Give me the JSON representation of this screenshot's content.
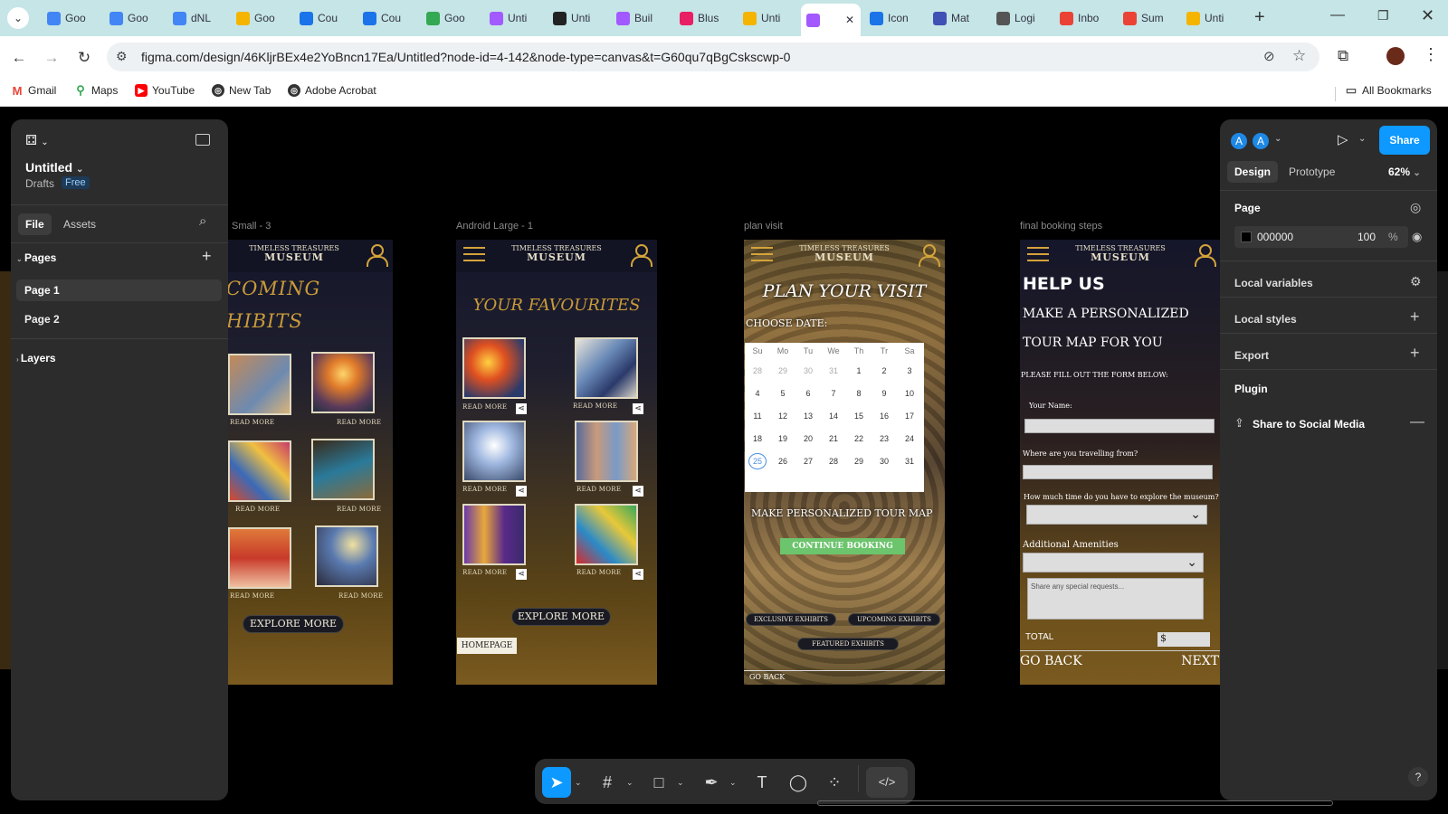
{
  "browser": {
    "tabs": [
      "Goo",
      "Goo",
      "dNL",
      "Goo",
      "Cou",
      "Cou",
      "Goo",
      "Unti",
      "Unti",
      "Buil",
      "Blus",
      "Unti",
      "",
      "Icon",
      "Mat",
      "Logi",
      "Inbo",
      "Sum",
      "Unti"
    ],
    "url": "figma.com/design/46KljrBEx4e2YoBncn17Ea/Untitled?node-id=4-142&node-type=canvas&t=G60qu7qBgCskscwp-0",
    "bookmarks": [
      "Gmail",
      "Maps",
      "YouTube",
      "New Tab",
      "Adobe Acrobat"
    ],
    "all_bookmarks": "All Bookmarks"
  },
  "left_panel": {
    "file_name": "Untitled",
    "drafts": "Drafts",
    "plan": "Free",
    "tab_file": "File",
    "tab_assets": "Assets",
    "pages_title": "Pages",
    "pages": [
      "Page 1",
      "Page 2"
    ],
    "layers_title": "Layers"
  },
  "right_panel": {
    "avatar": "A",
    "share": "Share",
    "tab_design": "Design",
    "tab_prototype": "Prototype",
    "zoom": "62%",
    "page_title": "Page",
    "page_color": "000000",
    "page_opacity": "100",
    "percent": "%",
    "local_variables": "Local variables",
    "local_styles": "Local styles",
    "export": "Export",
    "plugin": "Plugin",
    "share_social": "Share to Social Media",
    "help": "?"
  },
  "canvas": {
    "frame_labels": [
      "Small - 3",
      "Android Large - 1",
      "plan visit",
      "final booking steps"
    ],
    "logo_top": "TIMELESS TREASURES",
    "logo_main": "MUSEUM",
    "read_more": "READ MORE",
    "f1": {
      "line1": "COMING",
      "line2": "HIBITS",
      "explore": "EXPLORE MORE"
    },
    "f2": {
      "title": "YOUR FAVOURITES",
      "explore": "EXPLORE MORE",
      "home": "HOMEPAGE"
    },
    "f3": {
      "title": "PLAN YOUR VISIT",
      "choose": "CHOOSE DATE:",
      "days": [
        "Su",
        "Mo",
        "Tu",
        "We",
        "Th",
        "Tr",
        "Sa"
      ],
      "dates": [
        "28",
        "29",
        "30",
        "31",
        "1",
        "2",
        "3",
        "4",
        "5",
        "6",
        "7",
        "8",
        "9",
        "10",
        "11",
        "12",
        "13",
        "14",
        "15",
        "16",
        "17",
        "18",
        "19",
        "20",
        "21",
        "22",
        "23",
        "24",
        "25",
        "26",
        "27",
        "28",
        "29",
        "30",
        "31"
      ],
      "make": "MAKE PERSONALIZED TOUR MAP",
      "continue": "CONTINUE BOOKING",
      "exclusive": "EXCLUSIVE EXHIBITS",
      "upcoming": "UPCOMING EXHIBITS",
      "featured": "FEATURED EXHIBITS",
      "goback": "GO BACK"
    },
    "f4": {
      "help": "HELP US",
      "make": "MAKE A PERSONALIZED",
      "tour": "TOUR MAP FOR YOU",
      "fill": "PLEASE FILL OUT THE FORM BELOW:",
      "name": "Your Name:",
      "from": "Where are you travelling from?",
      "time": "How much time do you have to explore the museum?",
      "amen": "Additional Amenities",
      "special": "Share any special requests...",
      "total": "TOTAL",
      "dollar": "$",
      "goback": "GO BACK",
      "next": "NEXT"
    }
  },
  "colors": {
    "figma_blue": "#0d99ff",
    "gold": "#d4a33a",
    "green_btn": "#6cc46c"
  }
}
